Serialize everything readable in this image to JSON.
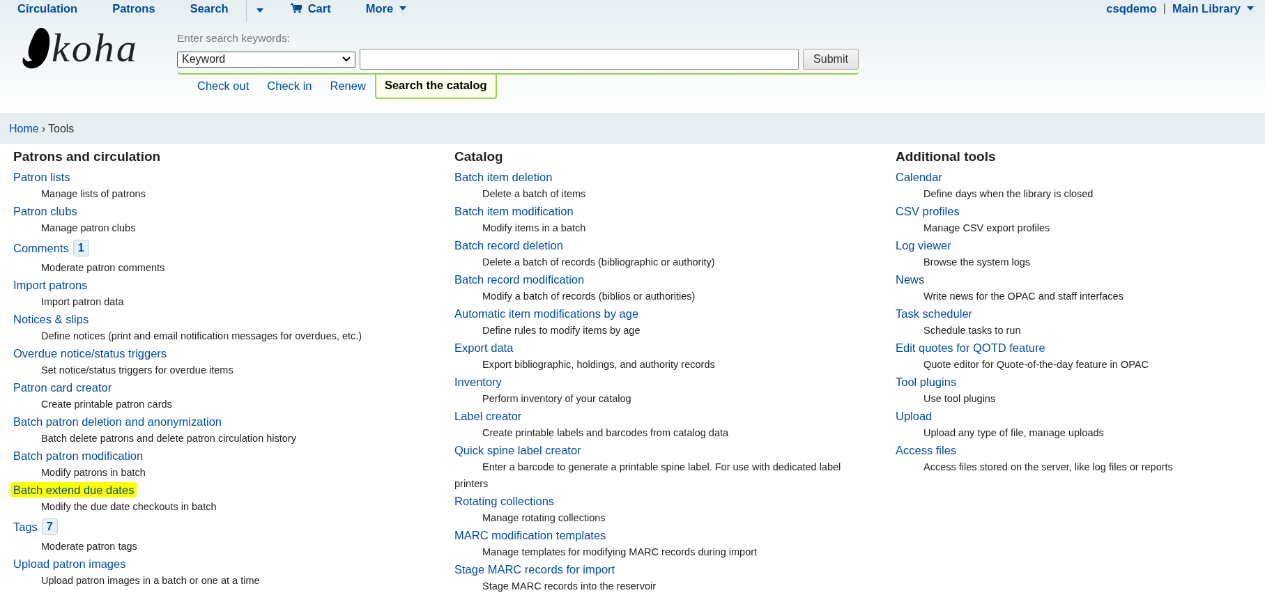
{
  "top_nav": {
    "items": [
      {
        "label": "Circulation",
        "kind": "link"
      },
      {
        "label": "Patrons",
        "kind": "link"
      },
      {
        "label": "Search",
        "kind": "link"
      },
      {
        "kind": "split-caret"
      },
      {
        "label": "Cart",
        "kind": "cart"
      },
      {
        "label": "More",
        "kind": "menu"
      }
    ],
    "user": "csqdemo",
    "separator": "|",
    "library": "Main Library"
  },
  "logo": {
    "text": "koha"
  },
  "search": {
    "label": "Enter search keywords:",
    "select_value": "Keyword",
    "submit": "Submit",
    "tabs": [
      {
        "label": "Check out",
        "selected": false
      },
      {
        "label": "Check in",
        "selected": false
      },
      {
        "label": "Renew",
        "selected": false
      },
      {
        "label": "Search the catalog",
        "selected": true
      }
    ]
  },
  "breadcrumbs": {
    "items": [
      "Home",
      "Tools"
    ],
    "separator": "›"
  },
  "columns": [
    {
      "title": "Patrons and circulation",
      "items": [
        {
          "label": "Patron lists",
          "description": "Manage lists of patrons",
          "highlighted": false
        },
        {
          "label": "Patron clubs",
          "description": "Manage patron clubs",
          "highlighted": false
        },
        {
          "label": "Comments",
          "badge": "1",
          "description": "Moderate patron comments",
          "highlighted": false
        },
        {
          "label": "Import patrons",
          "description": "Import patron data",
          "highlighted": false
        },
        {
          "label": "Notices & slips",
          "description": "Define notices (print and email notification messages for overdues, etc.)",
          "highlighted": false
        },
        {
          "label": "Overdue notice/status triggers",
          "description": "Set notice/status triggers for overdue items",
          "highlighted": false
        },
        {
          "label": "Patron card creator",
          "description": "Create printable patron cards",
          "highlighted": false
        },
        {
          "label": "Batch patron deletion and anonymization",
          "description": "Batch delete patrons and delete patron circulation history",
          "highlighted": false
        },
        {
          "label": "Batch patron modification",
          "description": "Modify patrons in batch",
          "highlighted": false
        },
        {
          "label": "Batch extend due dates",
          "description": "Modify the due date checkouts in batch",
          "highlighted": true
        },
        {
          "label": "Tags",
          "badge": "7",
          "description": "Moderate patron tags",
          "highlighted": false
        },
        {
          "label": "Upload patron images",
          "description": "Upload patron images in a batch or one at a time",
          "highlighted": false
        }
      ]
    },
    {
      "title": "Catalog",
      "items": [
        {
          "label": "Batch item deletion",
          "description": "Delete a batch of items",
          "highlighted": false
        },
        {
          "label": "Batch item modification",
          "description": "Modify items in a batch",
          "highlighted": false
        },
        {
          "label": "Batch record deletion",
          "description": "Delete a batch of records (bibliographic or authority)",
          "highlighted": false
        },
        {
          "label": "Batch record modification",
          "description": "Modify a batch of records (biblios or authorities)",
          "highlighted": false
        },
        {
          "label": "Automatic item modifications by age",
          "description": "Define rules to modify items by age",
          "highlighted": false
        },
        {
          "label": "Export data",
          "description": "Export bibliographic, holdings, and authority records",
          "highlighted": false
        },
        {
          "label": "Inventory",
          "description": "Perform inventory of your catalog",
          "highlighted": false
        },
        {
          "label": "Label creator",
          "description": "Create printable labels and barcodes from catalog data",
          "highlighted": false
        },
        {
          "label": "Quick spine label creator",
          "description": "Enter a barcode to generate a printable spine label. For use with dedicated label printers",
          "highlighted": false
        },
        {
          "label": "Rotating collections",
          "description": "Manage rotating collections",
          "highlighted": false
        },
        {
          "label": "MARC modification templates",
          "description": "Manage templates for modifying MARC records during import",
          "highlighted": false
        },
        {
          "label": "Stage MARC records for import",
          "description": "Stage MARC records into the reservoir",
          "highlighted": false
        }
      ]
    },
    {
      "title": "Additional tools",
      "items": [
        {
          "label": "Calendar",
          "description": "Define days when the library is closed",
          "highlighted": false
        },
        {
          "label": "CSV profiles",
          "description": "Manage CSV export profiles",
          "highlighted": false
        },
        {
          "label": "Log viewer",
          "description": "Browse the system logs",
          "highlighted": false
        },
        {
          "label": "News",
          "description": "Write news for the OPAC and staff interfaces",
          "highlighted": false
        },
        {
          "label": "Task scheduler",
          "description": "Schedule tasks to run",
          "highlighted": false
        },
        {
          "label": "Edit quotes for QOTD feature",
          "description": "Quote editor for Quote-of-the-day feature in OPAC",
          "highlighted": false
        },
        {
          "label": "Tool plugins",
          "description": "Use tool plugins",
          "highlighted": false
        },
        {
          "label": "Upload",
          "description": "Upload any type of file, manage uploads",
          "highlighted": false
        },
        {
          "label": "Access files",
          "description": "Access files stored on the server, like log files or reports",
          "highlighted": false
        }
      ]
    }
  ]
}
